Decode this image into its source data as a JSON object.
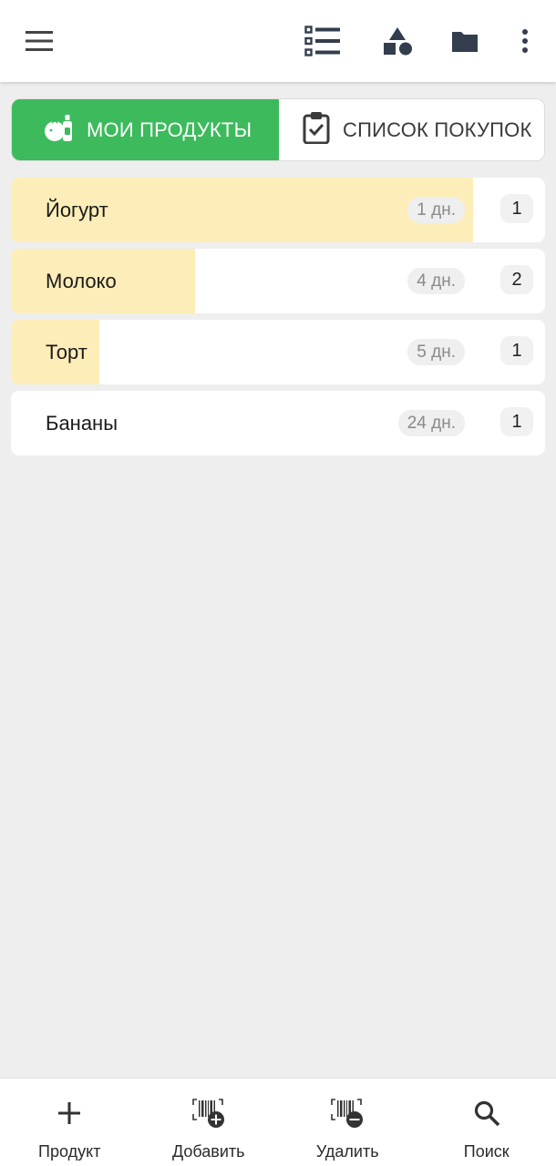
{
  "topbar": {
    "icons": [
      "menu-icon",
      "list-icon",
      "shapes-icon",
      "folder-icon",
      "more-vert-icon"
    ]
  },
  "tabs": {
    "my_products": "МОИ ПРОДУКТЫ",
    "shopping_list": "СПИСОК ПОКУПОК",
    "active_color": "#3cba5c"
  },
  "products": [
    {
      "name": "Йогурт",
      "days": "1 дн.",
      "qty": "1",
      "freshness_fill": 0.865
    },
    {
      "name": "Молоко",
      "days": "4 дн.",
      "qty": "2",
      "freshness_fill": 0.345
    },
    {
      "name": "Торт",
      "days": "5 дн.",
      "qty": "1",
      "freshness_fill": 0.165
    },
    {
      "name": "Бананы",
      "days": "24 дн.",
      "qty": "1",
      "freshness_fill": 0
    }
  ],
  "colors": {
    "expiry_fill": "#fdedb8",
    "background": "#eeeeee"
  },
  "bottom_nav": {
    "product": "Продукт",
    "add": "Добавить",
    "remove": "Удалить",
    "search": "Поиск"
  }
}
